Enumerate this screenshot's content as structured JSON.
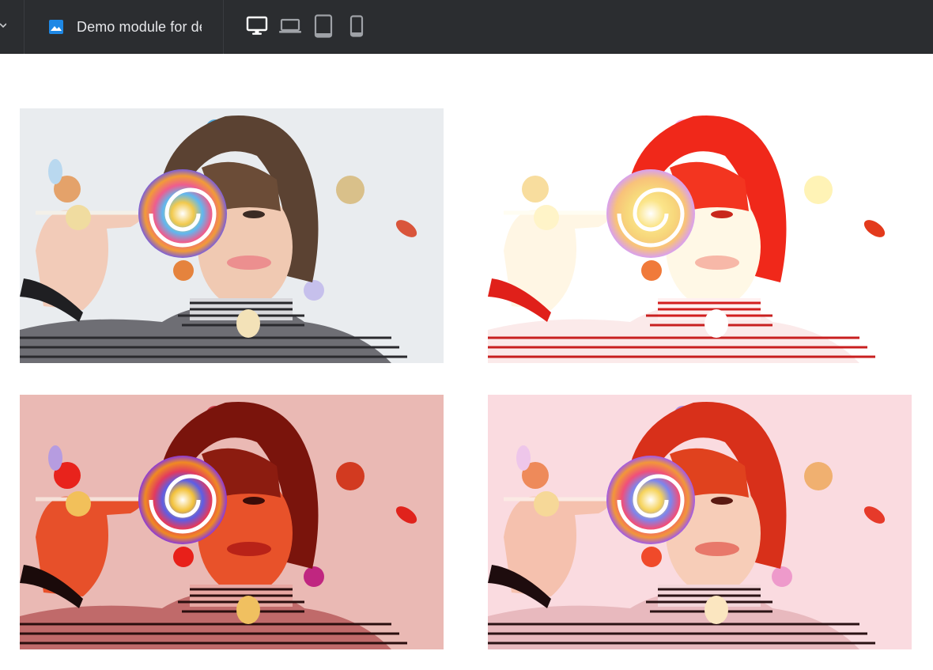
{
  "toolbar": {
    "module_title": "Demo module for de",
    "module_icon": "image-icon",
    "device_buttons": [
      {
        "name": "desktop-view",
        "icon": "monitor-icon",
        "active": true
      },
      {
        "name": "laptop-view",
        "icon": "laptop-icon",
        "active": false
      },
      {
        "name": "tablet-view",
        "icon": "tablet-icon",
        "active": false
      },
      {
        "name": "mobile-view",
        "icon": "phone-icon",
        "active": false
      }
    ],
    "colors": {
      "background": "#2b2d30",
      "icon_active": "#ffffff",
      "icon_inactive": "#9fa2a7",
      "accent": "#1e88e5"
    }
  },
  "gallery": {
    "images": [
      {
        "name": "photo-original",
        "filter": "none"
      },
      {
        "name": "photo-bright-warm",
        "filter": "overexposed-warm"
      },
      {
        "name": "photo-red-tint",
        "filter": "red-tint"
      },
      {
        "name": "photo-pink-tint",
        "filter": "pink-tint"
      }
    ]
  }
}
